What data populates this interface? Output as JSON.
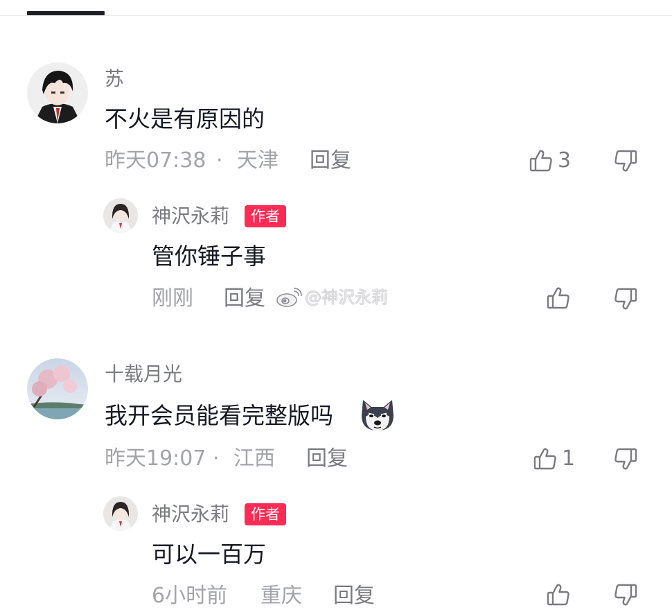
{
  "tabs": {
    "active_indicator": true
  },
  "comments": [
    {
      "username": "苏",
      "text": "不火是有原因的",
      "time": "昨天07:38",
      "separator": "·",
      "location": "天津",
      "reply_label": "回复",
      "likes": "3",
      "replies": [
        {
          "username": "神沢永莉",
          "badge": "作者",
          "text": "管你锤子事",
          "time": "刚刚",
          "reply_label": "回复",
          "likes": ""
        }
      ]
    },
    {
      "username": "十载月光",
      "text": "我开会员能看完整版吗",
      "emoji": "dog-emoji",
      "time": "昨天19:07",
      "separator": "·",
      "location": "江西",
      "reply_label": "回复",
      "likes": "1",
      "replies": [
        {
          "username": "神沢永莉",
          "badge": "作者",
          "text": "可以一百万",
          "time": "6小时前",
          "location": "重庆",
          "reply_label": "回复"
        }
      ]
    }
  ],
  "watermark": {
    "text": "@神沢永莉",
    "icon": "weibo-icon"
  },
  "colors": {
    "badge": "#fe2c55",
    "meta": "#a3a4a8",
    "secondary": "#7a7b80",
    "text": "#161823"
  },
  "icons": {
    "like": "thumb-up-icon",
    "dislike": "thumb-down-icon"
  }
}
